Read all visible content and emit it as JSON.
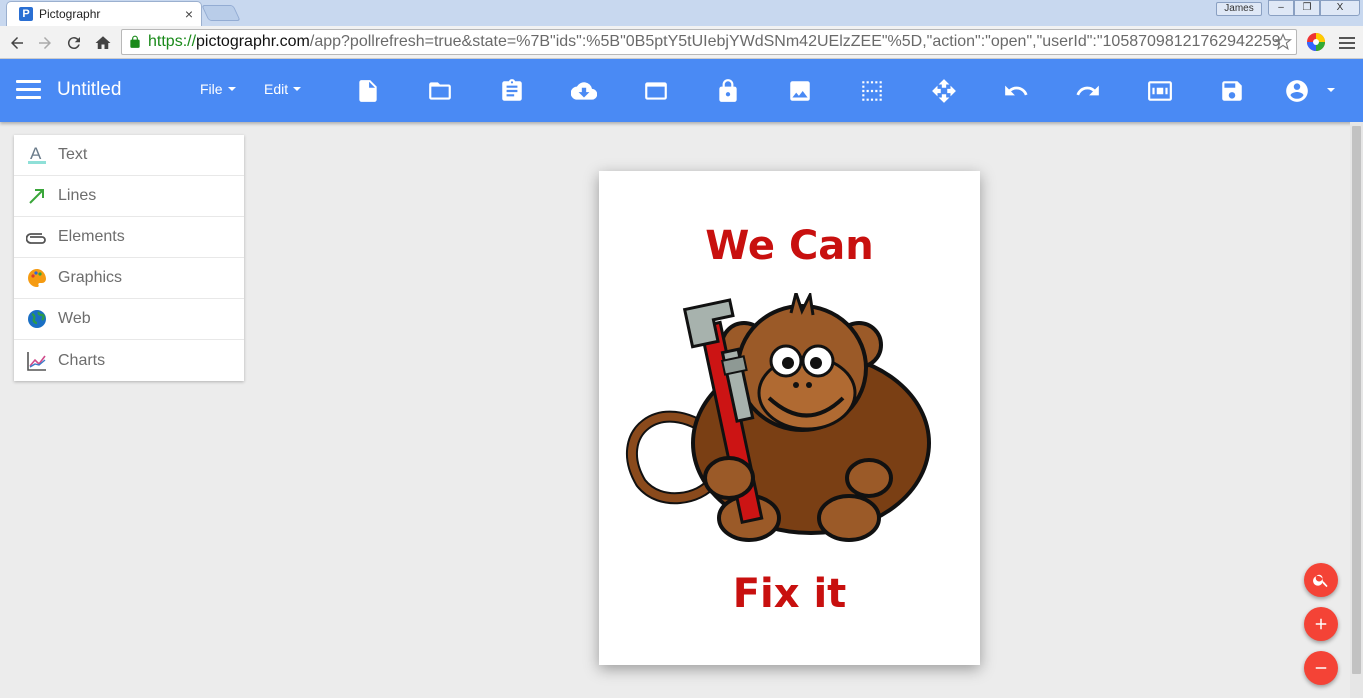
{
  "browser": {
    "tab_title": "Pictographr",
    "tab_favicon": "P",
    "tab_close": "×",
    "profile_name": "James",
    "window_min": "–",
    "window_max": "❐",
    "window_close": "X",
    "url_scheme": "https://",
    "url_domain": "pictographr.com",
    "url_path": "/app?pollrefresh=true&state=%7B\"ids\":%5B\"0B5ptY5tUIebjYWdSNm42UElzZEE\"%5D,\"action\":\"open\",\"userId\":\"10587098121762942259"
  },
  "appbar": {
    "doc_title": "Untitled",
    "menu_file": "File",
    "menu_edit": "Edit",
    "tools": [
      "new-file-icon",
      "folder-open-icon",
      "clipboard-icon",
      "cloud-download-icon",
      "window-icon",
      "lock-icon",
      "image-icon",
      "grid-icon",
      "move-icon",
      "undo-icon",
      "redo-icon",
      "fit-screen-icon",
      "save-icon",
      "account-icon"
    ]
  },
  "panel": {
    "items": [
      {
        "label": "Text",
        "icon": "text-icon"
      },
      {
        "label": "Lines",
        "icon": "arrow-icon"
      },
      {
        "label": "Elements",
        "icon": "paperclip-icon"
      },
      {
        "label": "Graphics",
        "icon": "palette-icon"
      },
      {
        "label": "Web",
        "icon": "globe-icon"
      },
      {
        "label": "Charts",
        "icon": "line-chart-icon"
      }
    ]
  },
  "canvas": {
    "headline_top": "We Can",
    "headline_bottom": "Fix it",
    "headline_color": "#c8100f"
  },
  "colors": {
    "appbar": "#4a8af4",
    "fab": "#f44336",
    "background": "#ececec"
  }
}
